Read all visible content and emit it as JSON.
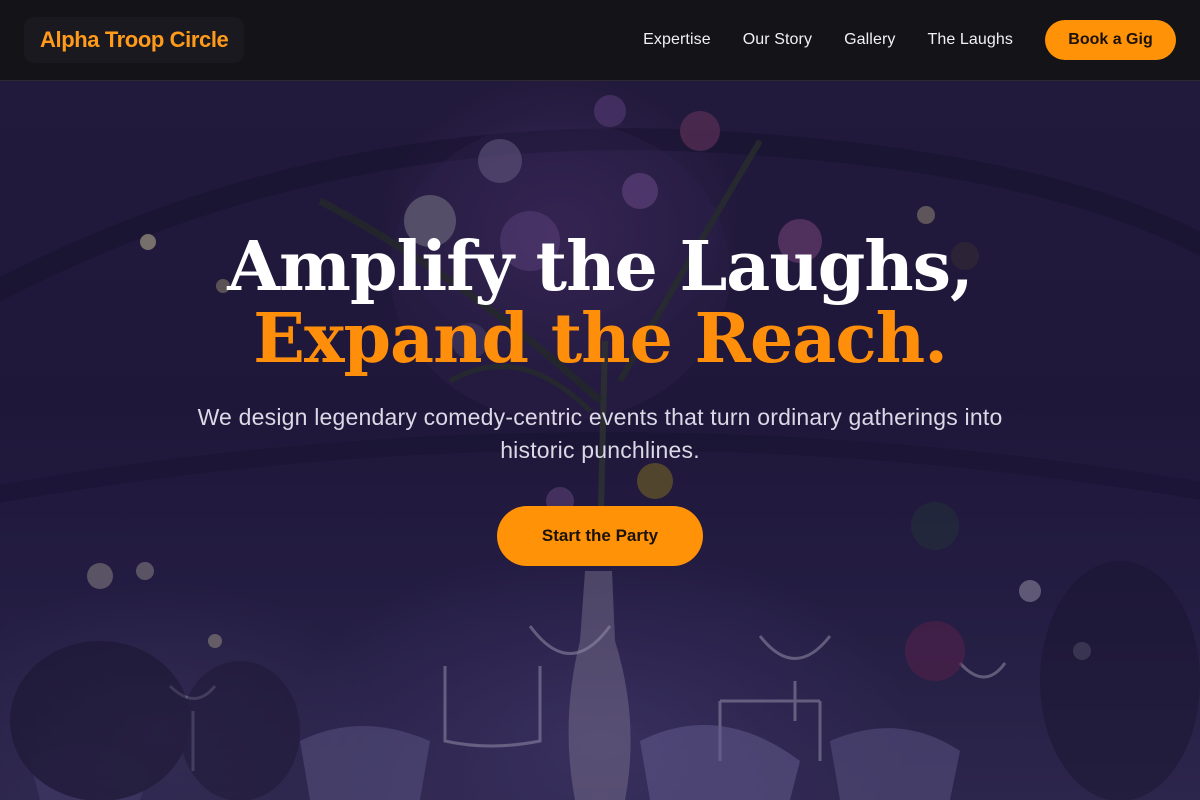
{
  "header": {
    "brand": "Alpha Troop Circle",
    "nav": [
      {
        "label": "Expertise"
      },
      {
        "label": "Our Story"
      },
      {
        "label": "Gallery"
      },
      {
        "label": "The Laughs"
      }
    ],
    "cta_label": "Book a Gig"
  },
  "hero": {
    "title_line1": "Amplify the Laughs,",
    "title_line2": "Expand the Reach.",
    "subtitle": "We design legendary comedy-centric events that turn ordinary gatherings into historic punchlines.",
    "cta_label": "Start the Party",
    "background_image": "dim purple banquet hall with floral centerpiece and glassware"
  },
  "colors": {
    "accent": "#ff9207",
    "header_bg": "#141318",
    "hero_tint": "#2a2148"
  }
}
